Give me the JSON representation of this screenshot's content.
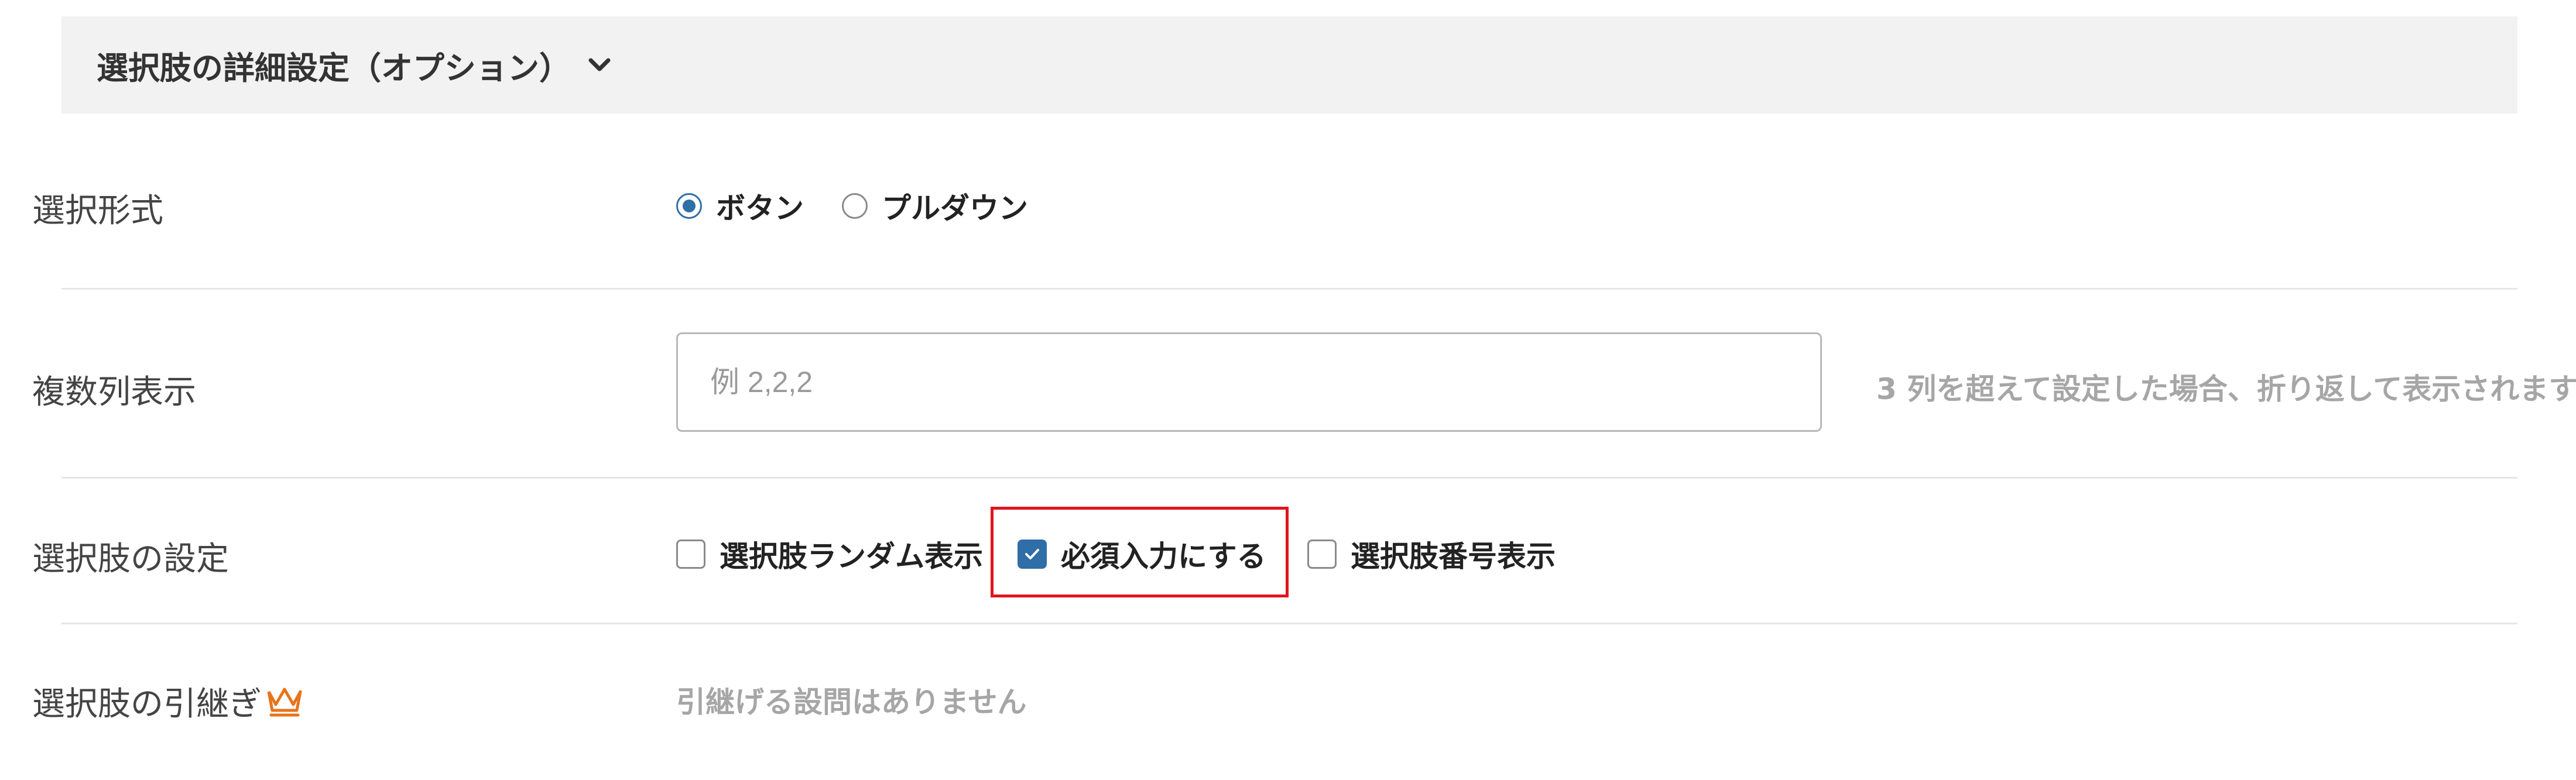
{
  "header": {
    "title": "選択肢の詳細設定（オプション）",
    "chevron_icon": "chevron-down-icon"
  },
  "rows": {
    "selection_format": {
      "label": "選択形式",
      "options": [
        {
          "label": "ボタン",
          "selected": true
        },
        {
          "label": "プルダウン",
          "selected": false
        }
      ]
    },
    "multi_column": {
      "label": "複数列表示",
      "input_value": "",
      "placeholder": "例 2,2,2",
      "hint": "3 列を超えて設定した場合、折り返して表示されます"
    },
    "choice_settings": {
      "label": "選択肢の設定",
      "checkboxes": [
        {
          "label": "選択肢ランダム表示",
          "checked": false
        },
        {
          "label": "必須入力にする",
          "checked": true
        },
        {
          "label": "選択肢番号表示",
          "checked": false
        }
      ]
    },
    "choice_inherit": {
      "label": "選択肢の引継ぎ",
      "premium_icon": "crown-icon",
      "value": "引継げる設問はありません"
    }
  },
  "colors": {
    "accent": "#2f6ea7",
    "highlight": "#e0141e",
    "crown": "#e8731a",
    "header_bg": "#f2f2f2",
    "muted_text": "#a6a6a6"
  }
}
